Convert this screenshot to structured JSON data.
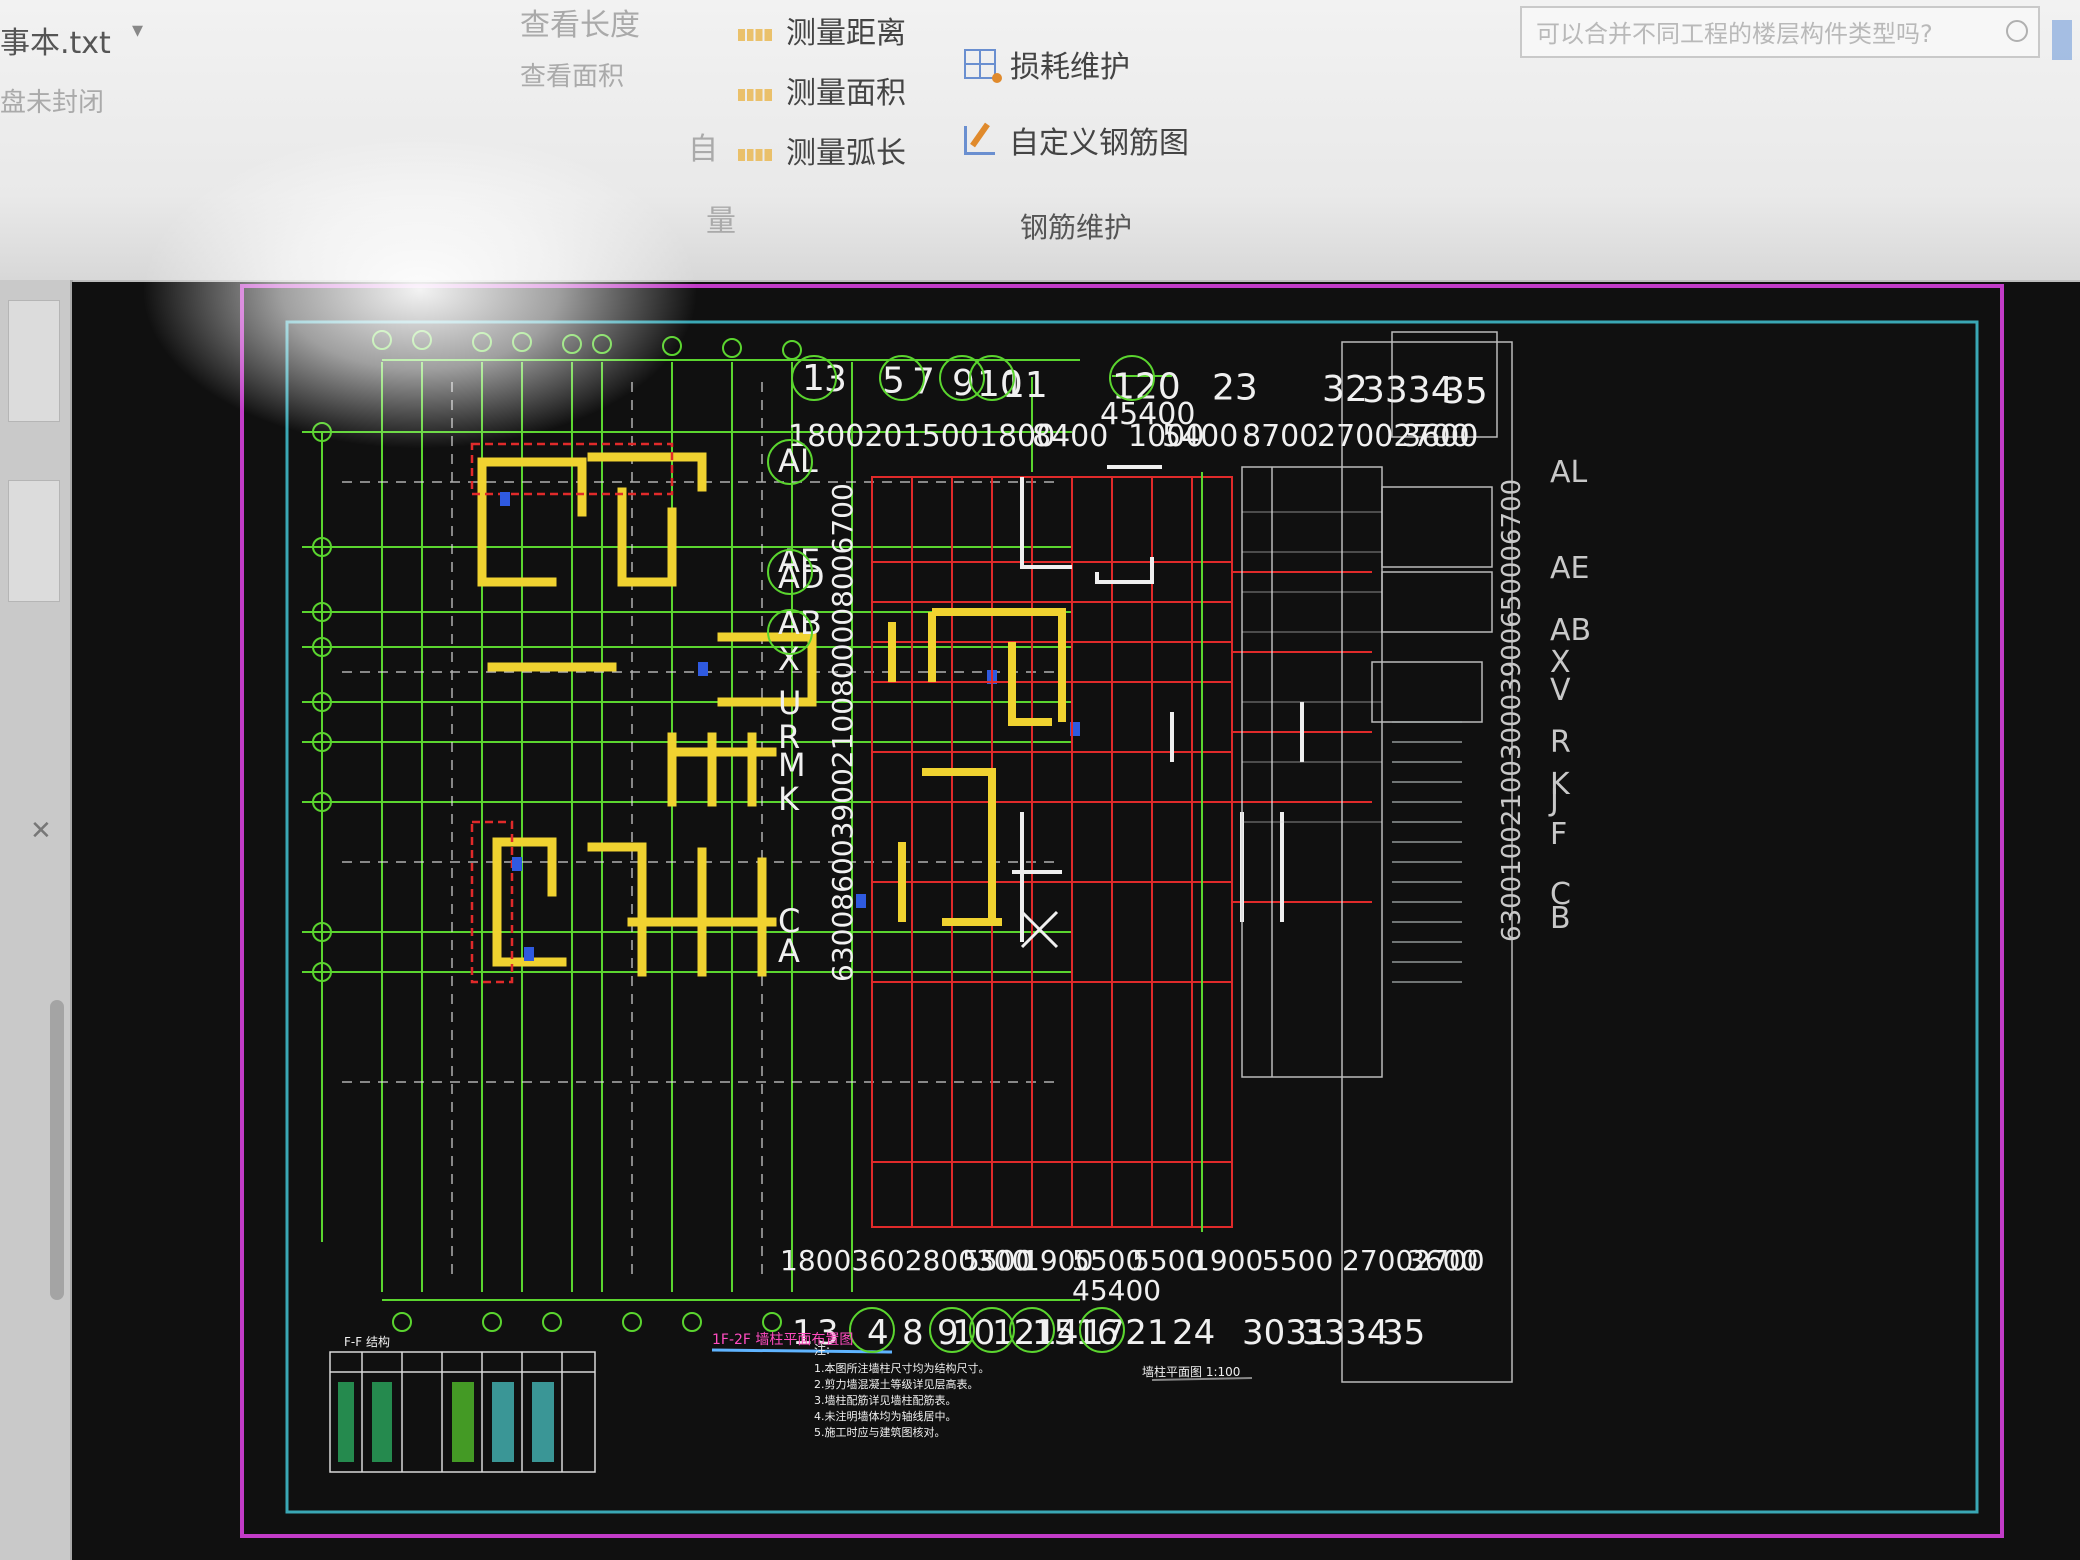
{
  "ribbon": {
    "file_tab": "事本.txt",
    "file_sub": "盘未封闭",
    "faded_top": "查看长度",
    "faded_second": "查看面积",
    "faded_mid": "自",
    "faded_bottom": "量",
    "measure_buttons": [
      {
        "label": "测量距离",
        "icon": "ruler-icon"
      },
      {
        "label": "测量面积",
        "icon": "ruler-icon"
      },
      {
        "label": "测量弧长",
        "icon": "ruler-icon"
      }
    ],
    "rebar_buttons": [
      {
        "label": "损耗维护",
        "icon": "grid-icon"
      },
      {
        "label": "自定义钢筋图",
        "icon": "pencil-icon"
      }
    ],
    "group_label": "钢筋维护",
    "search_placeholder": "可以合并不同工程的楼层构件类型吗?"
  },
  "drawing": {
    "colors": {
      "background": "#101010",
      "border": "#c23cc8",
      "frame": "#3aa7b5",
      "axis": "#5bd52f",
      "wall": "#f0d230",
      "red": "#e02a2a",
      "text": "#f0f0f0"
    },
    "top_axes": [
      "1",
      "3",
      "5",
      "7",
      "9",
      "10",
      "11",
      "120",
      "23",
      "32",
      "3334",
      "35"
    ],
    "top_dims": [
      "18002015001800",
      "8400",
      "1000",
      "5400",
      "8700",
      "27002700",
      "3600"
    ],
    "top_total": "45400",
    "bottom_axes": [
      "1",
      "3",
      "4",
      "8",
      "9",
      "10",
      "1214",
      "1516",
      "1721",
      "24",
      "3031",
      "3334",
      "35"
    ],
    "bottom_dims": [
      "18003602800300",
      "5500",
      "1900",
      "5500",
      "5500",
      "1900",
      "5500",
      "27002700",
      "3600"
    ],
    "bottom_total": "45400",
    "left_rows": [
      "AL",
      "AE",
      "AD",
      "AB",
      "X",
      "U",
      "R",
      "M",
      "K",
      "C",
      "A"
    ],
    "right_rows": [
      "AL",
      "AE",
      "AB",
      "X",
      "V",
      "R",
      "K",
      "J",
      "F",
      "C",
      "B"
    ],
    "vertical_dims_left": "6300860039002100800008006700",
    "vertical_dims_right": "6300100210030003900650006700",
    "plan_title": "1F-2F 墙柱平面布置图",
    "table_title": "F-F 结构",
    "notes_title": "注:",
    "notes": [
      "1.本图所注墙柱尺寸均为结构尺寸。",
      "2.剪力墙混凝土等级详见层高表。",
      "3.墙柱配筋详见墙柱配筋表。",
      "4.未注明墙体均为轴线居中。",
      "5.施工时应与建筑图核对。"
    ],
    "note_scale": "墙柱平面图 1:100"
  }
}
